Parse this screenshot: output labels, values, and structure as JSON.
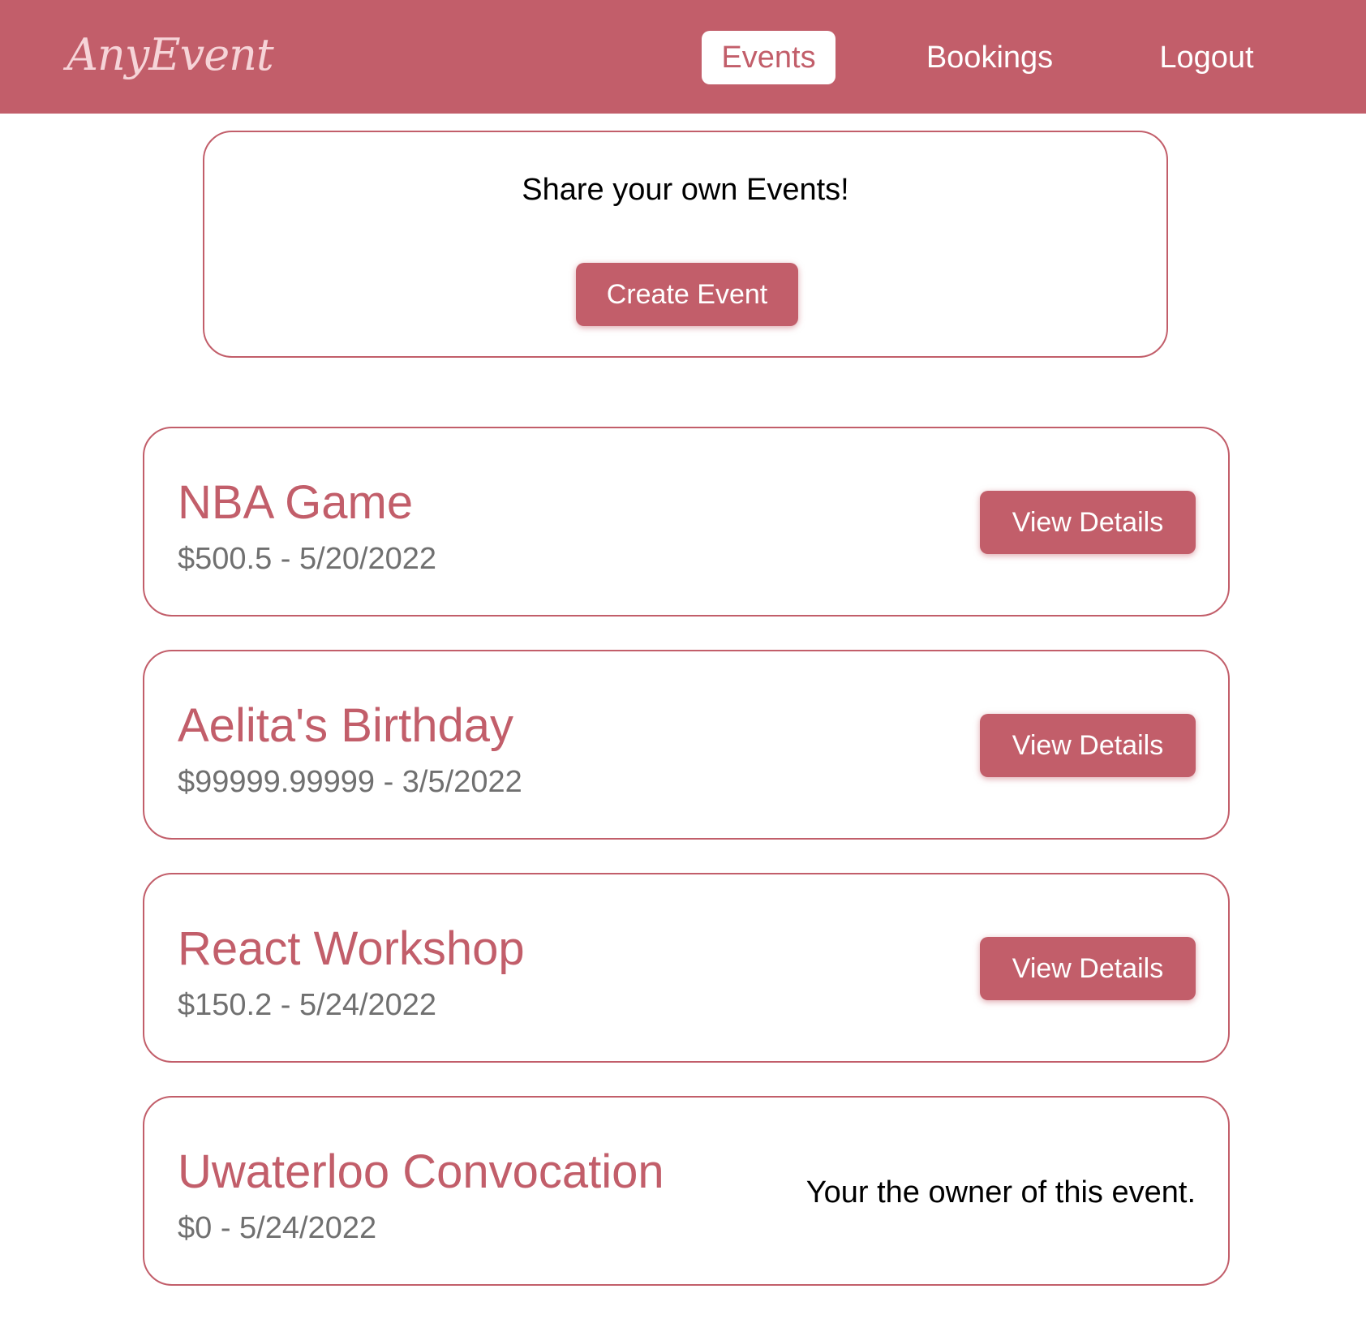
{
  "app": {
    "name": "AnyEvent"
  },
  "nav": {
    "items": [
      {
        "label": "Events",
        "active": true
      },
      {
        "label": "Bookings",
        "active": false
      },
      {
        "label": "Logout",
        "active": false
      }
    ]
  },
  "create_section": {
    "title": "Share your own Events!",
    "button_label": "Create Event"
  },
  "events": [
    {
      "title": "NBA Game",
      "price": "$500.5",
      "date": "5/20/2022",
      "meta": "$500.5 - 5/20/2022",
      "action_label": "View Details",
      "owner_note": ""
    },
    {
      "title": "Aelita's Birthday",
      "price": "$99999.99999",
      "date": "3/5/2022",
      "meta": "$99999.99999 - 3/5/2022",
      "action_label": "View Details",
      "owner_note": ""
    },
    {
      "title": "React Workshop",
      "price": "$150.2",
      "date": "5/24/2022",
      "meta": "$150.2 - 5/24/2022",
      "action_label": "View Details",
      "owner_note": ""
    },
    {
      "title": "Uwaterloo Convocation",
      "price": "$0",
      "date": "5/24/2022",
      "meta": "$0 - 5/24/2022",
      "action_label": "",
      "owner_note": "Your the owner of this event."
    }
  ],
  "colors": {
    "brand": "#c25e6a",
    "logo_text": "#f6d4d8",
    "meta_text": "#707070",
    "background": "#ffffff"
  }
}
